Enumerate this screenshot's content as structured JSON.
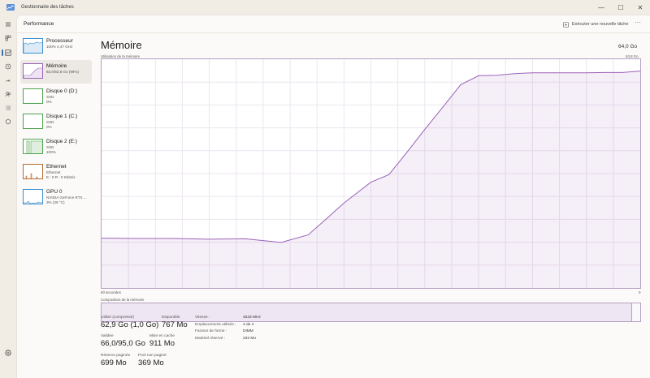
{
  "window": {
    "title": "Gestionnaire des tâches",
    "controls": {
      "minimize": "—",
      "maximize": "☐",
      "close": "✕"
    }
  },
  "header": {
    "page_title": "Performance",
    "run_task_label": "Exécuter une nouvelle tâche",
    "more_label": "···"
  },
  "rail_icons": [
    "hamburger-icon",
    "processes-icon",
    "performance-icon",
    "history-icon",
    "startup-icon",
    "users-icon",
    "details-icon",
    "services-icon",
    "settings-icon"
  ],
  "sidebar": {
    "items": [
      {
        "name": "Processeur",
        "sub1": "100% 4,47 GHz",
        "sub2": "",
        "color": "#3c8fd0"
      },
      {
        "name": "Mémoire",
        "sub1": "63,0/63,8 Go (99%)",
        "sub2": "",
        "color": "#9a62b8"
      },
      {
        "name": "Disque 0 (D:)",
        "sub1": "SSD",
        "sub2": "0%",
        "color": "#4ca34c"
      },
      {
        "name": "Disque 1 (C:)",
        "sub1": "SSD",
        "sub2": "0%",
        "color": "#4ca34c"
      },
      {
        "name": "Disque 2 (E:)",
        "sub1": "SSD",
        "sub2": "100%",
        "color": "#4ca34c"
      },
      {
        "name": "Ethernet",
        "sub1": "Ethernet",
        "sub2": "E : 0 R : 0 Kbits/s",
        "color": "#b86a2d"
      },
      {
        "name": "GPU 0",
        "sub1": "NVIDIA GeForce RTX ...",
        "sub2": "3% (29 °C)",
        "color": "#3c8fd0"
      }
    ]
  },
  "detail": {
    "title": "Mémoire",
    "total": "64,0 Go",
    "chart_label": "Utilisation de la mémoire",
    "chart_max": "63,8 Go",
    "axis_left": "60 secondes",
    "axis_right": "0",
    "composition_label": "Composition de la mémoire",
    "composition_used_fraction": 0.985
  },
  "chart_data": {
    "type": "area",
    "title": "Utilisation de la mémoire",
    "x_range": [
      60,
      0
    ],
    "ylim": [
      0,
      63.8
    ],
    "unit": "Go",
    "color": "#9a62b8",
    "x": [
      60,
      56,
      52,
      48,
      44,
      40,
      37,
      35,
      33,
      30,
      28,
      26,
      24,
      22,
      20,
      18,
      16,
      14,
      12,
      10,
      8,
      6,
      4,
      2,
      0
    ],
    "values": [
      13.9,
      13.8,
      13.8,
      13.6,
      13.7,
      12.7,
      14.8,
      19.2,
      23.7,
      29.5,
      31.6,
      37.8,
      44.2,
      50.4,
      56.7,
      59.2,
      59.3,
      59.8,
      60.0,
      60.0,
      60.0,
      60.0,
      60.1,
      60.1,
      60.5
    ]
  },
  "stats": {
    "in_use_label": "Utilisé (compressé)",
    "in_use_value": "62,9 Go (1,0 Go)",
    "available_label": "Disponible",
    "available_value": "767 Mo",
    "committed_label": "Validée",
    "committed_value": "66,0/95,0 Go",
    "cached_label": "Mise en cache",
    "cached_value": "911 Mo",
    "paged_label": "Réserve paginée",
    "paged_value": "699 Mo",
    "nonpaged_label": "Pool non paginé",
    "nonpaged_value": "369 Mo"
  },
  "specs": [
    {
      "key": "Vitesse :",
      "value": "4533 MHz"
    },
    {
      "key": "Emplacements utilisés :",
      "value": "4 de 4"
    },
    {
      "key": "Facteur de forme :",
      "value": "DIMM"
    },
    {
      "key": "Matériel réservé :",
      "value": "232 Mo"
    }
  ]
}
